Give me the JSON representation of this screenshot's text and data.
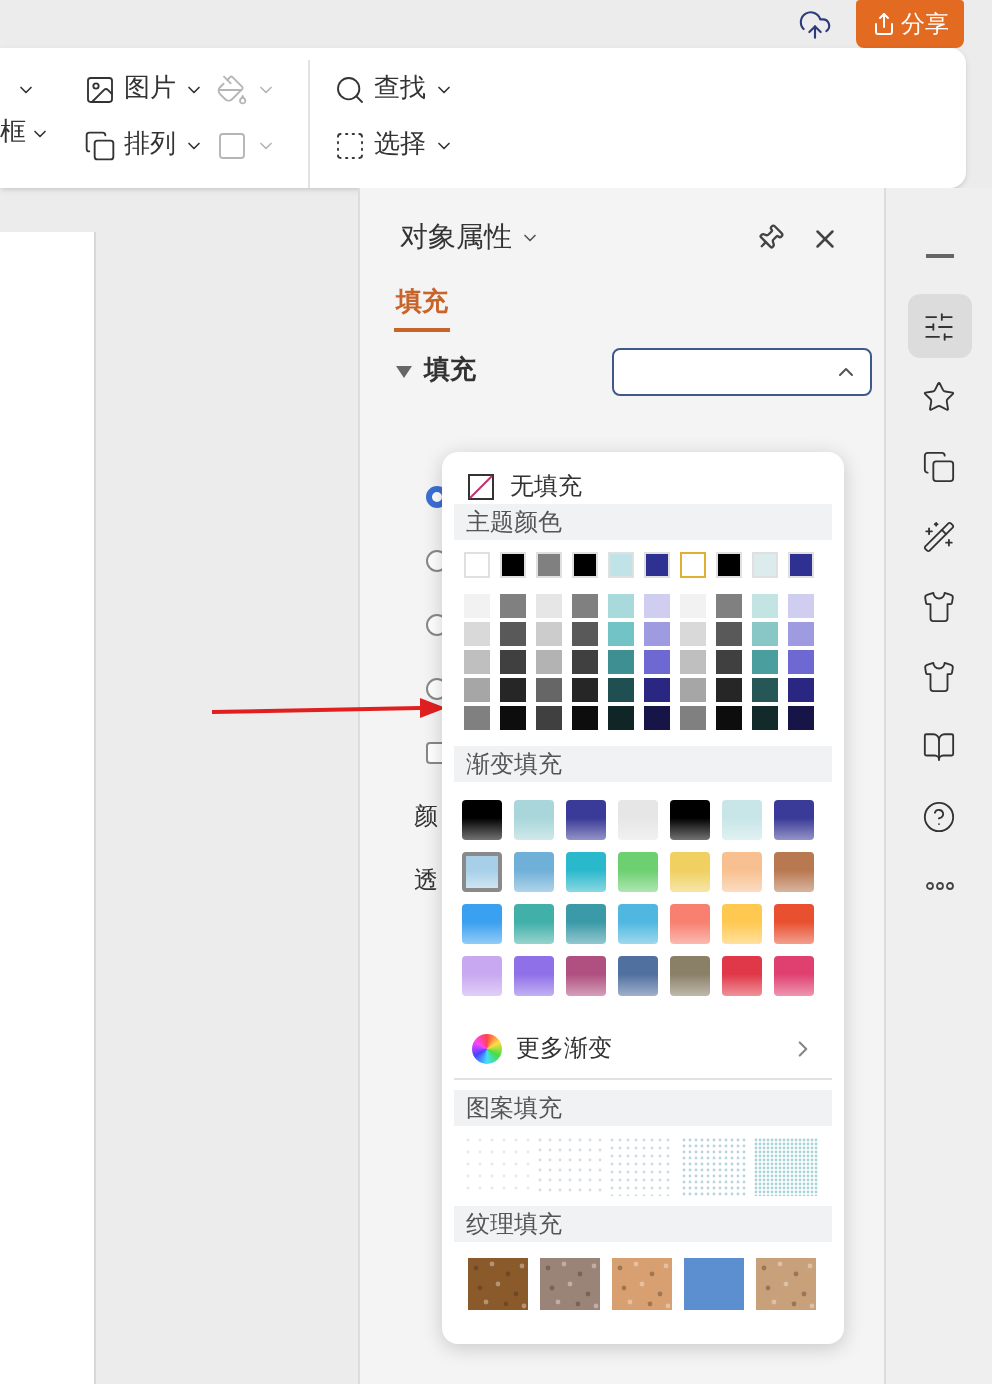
{
  "top_bar": {
    "share_button": {
      "label": "分享"
    }
  },
  "ribbon": {
    "cut_label": "框",
    "items": [
      {
        "kind": "picture",
        "label": "图片",
        "disabled": false
      },
      {
        "kind": "arrange",
        "label": "排列",
        "disabled": false
      },
      {
        "kind": "fill",
        "disabled": true
      },
      {
        "kind": "outline",
        "disabled": true
      },
      {
        "kind": "find",
        "label": "查找",
        "disabled": false
      },
      {
        "kind": "select",
        "label": "选择",
        "disabled": false
      }
    ]
  },
  "panel": {
    "title": "对象属性",
    "tabs": [
      {
        "label": "填充",
        "selected": true
      }
    ],
    "section": {
      "label": "填充",
      "expanded": true
    },
    "dropdown": {
      "open": true
    },
    "options": [
      {
        "kind": "radio",
        "selected": true
      },
      {
        "kind": "radio",
        "selected": false
      },
      {
        "kind": "radio",
        "selected": false
      },
      {
        "kind": "radio",
        "selected": false
      },
      {
        "kind": "checkbox",
        "checked": false
      }
    ],
    "labels": [
      "颜",
      "透"
    ]
  },
  "fill_popup": {
    "no_fill": "无填充",
    "theme_header": "主题颜色",
    "theme_colors": [
      {
        "color": "#ffffff",
        "selected": false
      },
      {
        "color": "#000000",
        "selected": false
      },
      {
        "color": "#808080",
        "selected": false
      },
      {
        "color": "#000000",
        "selected": false
      },
      {
        "color": "#bfe3e6",
        "selected": false
      },
      {
        "color": "#2e3192",
        "selected": false
      },
      {
        "color": "#ffffff",
        "selected": true
      },
      {
        "color": "#000000",
        "selected": false
      },
      {
        "color": "#dcecec",
        "selected": false
      },
      {
        "color": "#2e3192",
        "selected": false
      }
    ],
    "shade_rows": [
      [
        {
          "color": "#f2f2f2"
        },
        {
          "color": "#808080"
        },
        {
          "color": "#e6e6e6"
        },
        {
          "color": "#808080"
        },
        {
          "color": "#a8dadc"
        },
        {
          "color": "#cfcdf0"
        },
        {
          "color": "#f2f2f2"
        },
        {
          "color": "#808080"
        },
        {
          "color": "#c4e3e3"
        },
        {
          "color": "#cfcdf0"
        }
      ],
      [
        {
          "color": "#d9d9d9"
        },
        {
          "color": "#595959"
        },
        {
          "color": "#cccccc"
        },
        {
          "color": "#595959"
        },
        {
          "color": "#72c3c6"
        },
        {
          "color": "#9f9be1"
        },
        {
          "color": "#d9d9d9"
        },
        {
          "color": "#595959"
        },
        {
          "color": "#89c7c7"
        },
        {
          "color": "#9f9be1"
        }
      ],
      [
        {
          "color": "#bfbfbf"
        },
        {
          "color": "#404040"
        },
        {
          "color": "#b3b3b3"
        },
        {
          "color": "#404040"
        },
        {
          "color": "#3d8f92"
        },
        {
          "color": "#6e69d2"
        },
        {
          "color": "#bfbfbf"
        },
        {
          "color": "#404040"
        },
        {
          "color": "#4a9e9e"
        },
        {
          "color": "#6e69d2"
        }
      ],
      [
        {
          "color": "#a6a6a6"
        },
        {
          "color": "#262626"
        },
        {
          "color": "#666666"
        },
        {
          "color": "#262626"
        },
        {
          "color": "#1f4f50"
        },
        {
          "color": "#2a2783"
        },
        {
          "color": "#a6a6a6"
        },
        {
          "color": "#262626"
        },
        {
          "color": "#275656"
        },
        {
          "color": "#2a2783"
        }
      ],
      [
        {
          "color": "#808080"
        },
        {
          "color": "#0d0d0d"
        },
        {
          "color": "#404040"
        },
        {
          "color": "#0d0d0d"
        },
        {
          "color": "#0f2526"
        },
        {
          "color": "#171548"
        },
        {
          "color": "#808080"
        },
        {
          "color": "#0d0d0d"
        },
        {
          "color": "#132a2a"
        },
        {
          "color": "#171548"
        }
      ]
    ],
    "gradient_header": "渐变填充",
    "gradients": [
      {
        "color": "#000000",
        "selected": false
      },
      {
        "color": "#a9d6da",
        "selected": false
      },
      {
        "color": "#3a3a98",
        "selected": false
      },
      {
        "color": "#e6e6e6",
        "selected": false
      },
      {
        "color": "#000000",
        "selected": false
      },
      {
        "color": "#c8e6e8",
        "selected": false
      },
      {
        "color": "#3a3a98",
        "selected": false
      },
      {
        "color": "#a7d0e8",
        "selected": true
      },
      {
        "color": "#6fb0d8",
        "selected": false
      },
      {
        "color": "#2ab8cc",
        "selected": false
      },
      {
        "color": "#6cd070",
        "selected": false
      },
      {
        "color": "#f0d060",
        "selected": false
      },
      {
        "color": "#f8c090",
        "selected": false
      },
      {
        "color": "#b87850",
        "selected": false
      },
      {
        "color": "#3aa0f0",
        "selected": false
      },
      {
        "color": "#40b0a8",
        "selected": false
      },
      {
        "color": "#3a9aa8",
        "selected": false
      },
      {
        "color": "#50b8e0",
        "selected": false
      },
      {
        "color": "#f88070",
        "selected": false
      },
      {
        "color": "#ffc850",
        "selected": false
      },
      {
        "color": "#e85030",
        "selected": false
      },
      {
        "color": "#c8a8f0",
        "selected": false
      },
      {
        "color": "#9070e8",
        "selected": false
      },
      {
        "color": "#b05080",
        "selected": false
      },
      {
        "color": "#5070a0",
        "selected": false
      },
      {
        "color": "#8a8068",
        "selected": false
      },
      {
        "color": "#e03848",
        "selected": false
      },
      {
        "color": "#e04070",
        "selected": false
      }
    ],
    "more_gradients": "更多渐变",
    "pattern_header": "图案填充",
    "patterns": [
      {
        "color": "#e4e8ec"
      },
      {
        "color": "#d4dce2"
      },
      {
        "color": "#c8dde2"
      },
      {
        "color": "#b8d4dc"
      },
      {
        "color": "#a8d4d8"
      }
    ],
    "texture_header": "纹理填充",
    "textures": [
      {
        "color": "#8b5a2b"
      },
      {
        "color": "#9a8478"
      },
      {
        "color": "#d8a070"
      },
      {
        "color": "#5b8fd0"
      },
      {
        "color": "#c8a07a"
      }
    ]
  },
  "sidebar_tools": [
    {
      "kind": "collapse",
      "selected": false
    },
    {
      "kind": "adjust",
      "selected": true
    },
    {
      "kind": "effects",
      "selected": false
    },
    {
      "kind": "swap",
      "selected": false
    },
    {
      "kind": "magic",
      "selected": false
    },
    {
      "kind": "style",
      "selected": false
    },
    {
      "kind": "theme",
      "selected": false
    },
    {
      "kind": "reader",
      "selected": false
    },
    {
      "kind": "help",
      "selected": false
    },
    {
      "kind": "more",
      "selected": false
    }
  ]
}
